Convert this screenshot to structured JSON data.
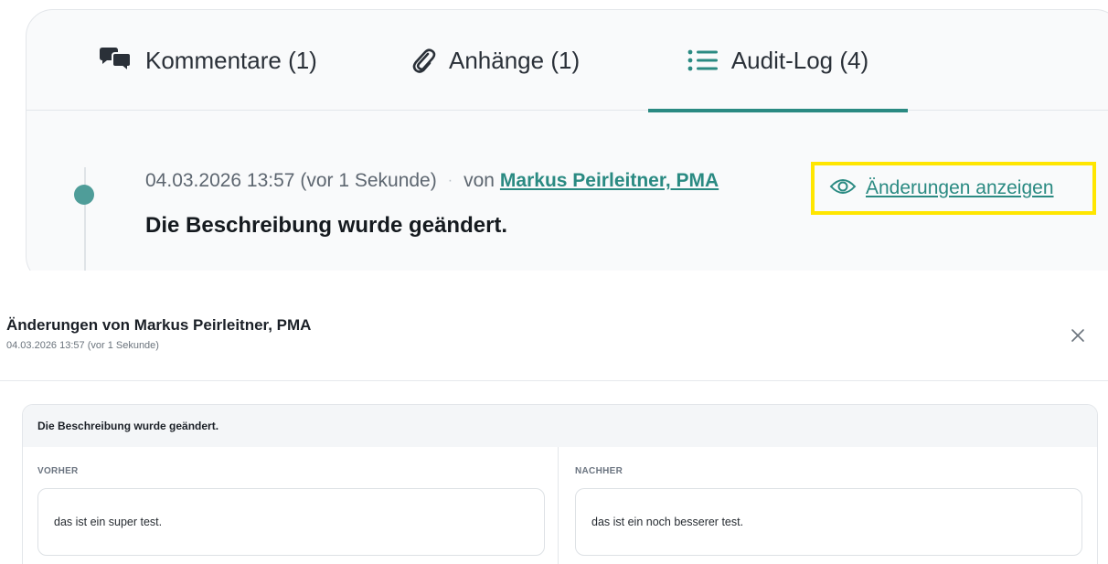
{
  "tabs": {
    "comments": "Kommentare (1)",
    "attachments": "Anhänge (1)",
    "audit": "Audit-Log (4)"
  },
  "entry": {
    "timestamp": "04.03.2026 13:57 (vor 1 Sekunde)",
    "separator": "·",
    "by_prefix": "von",
    "author": "Markus Peirleitner, PMA",
    "show_changes": "Änderungen anzeigen",
    "title": "Die Beschreibung wurde geändert."
  },
  "dialog": {
    "title": "Änderungen von Markus Peirleitner, PMA",
    "subtitle": "04.03.2026 13:57 (vor 1 Sekunde)",
    "change_title": "Die Beschreibung wurde geändert.",
    "before_label": "VORHER",
    "after_label": "NACHHER",
    "before_value": "das ist ein super test.",
    "after_value": "das ist ein noch besserer test."
  },
  "colors": {
    "accent": "#2a8a82",
    "dot": "#4f9d99",
    "highlight": "#ffe600"
  },
  "icons": [
    "comments-icon",
    "paperclip-icon",
    "list-icon",
    "eye-icon",
    "close-icon"
  ]
}
